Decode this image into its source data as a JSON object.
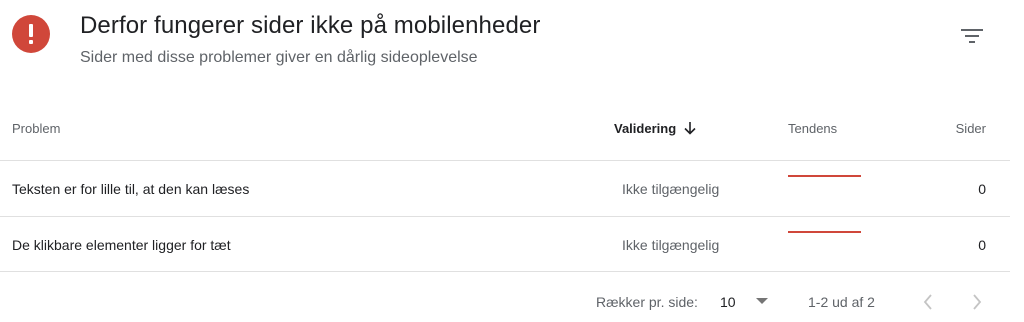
{
  "header": {
    "title": "Derfor fungerer sider ikke på mobilenheder",
    "subtitle": "Sider med disse problemer giver en dårlig sideoplevelse",
    "icon": "error-icon",
    "accent_color": "#d0473a"
  },
  "table": {
    "columns": {
      "problem": "Problem",
      "validation": "Validering",
      "trend": "Tendens",
      "pages": "Sider"
    },
    "sort": {
      "column": "validation",
      "direction": "descending",
      "icon": "arrow-down-icon"
    },
    "rows": [
      {
        "problem": "Teksten er for lille til, at den kan læses",
        "validation": "Ikke tilgængelig",
        "pages": "0"
      },
      {
        "problem": "De klikbare elementer ligger for tæt",
        "validation": "Ikke tilgængelig",
        "pages": "0"
      }
    ]
  },
  "pagination": {
    "rows_per_page_label": "Rækker pr. side:",
    "rows_per_page_value": "10",
    "range": "1-2 ud af 2"
  },
  "icons": {
    "filter": "filter-icon",
    "dropdown": "caret-down-icon",
    "prev": "chevron-left-icon",
    "next": "chevron-right-icon"
  }
}
